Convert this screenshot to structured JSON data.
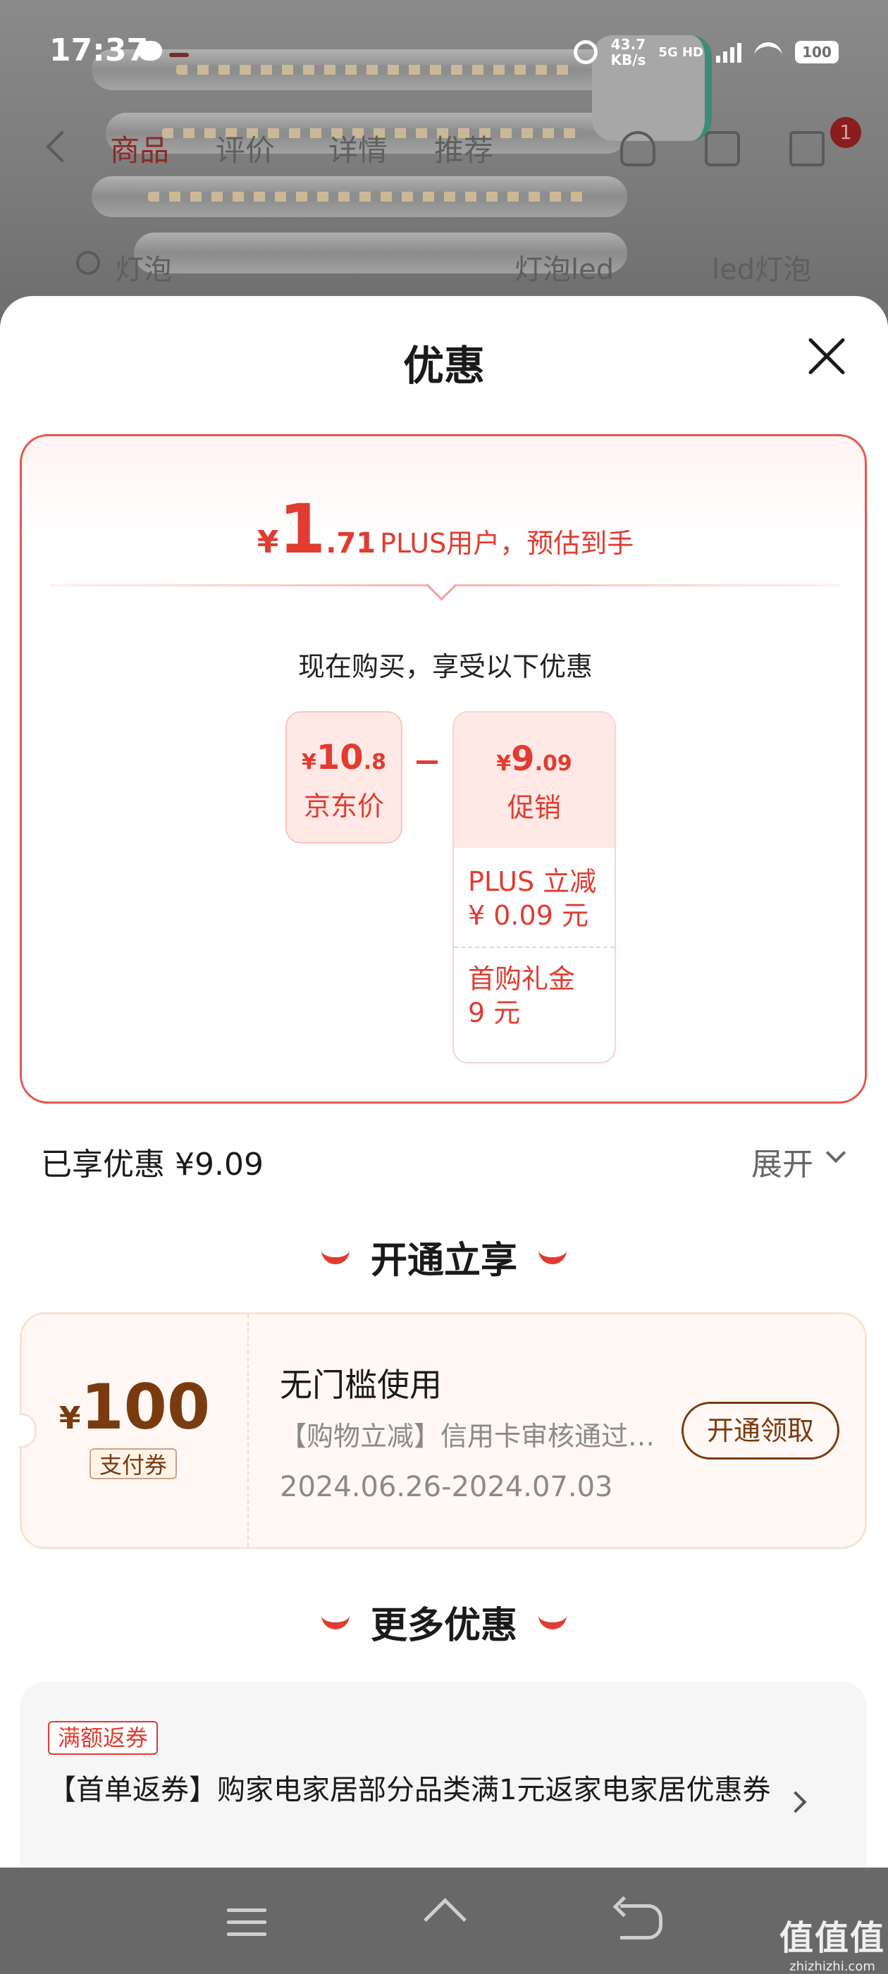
{
  "status_bar": {
    "time": "17:37",
    "net_speed_value": "43.7",
    "net_speed_unit": "KB/s",
    "network": "5G HD",
    "battery": "100"
  },
  "product_nav": {
    "tabs": [
      "商品",
      "评价",
      "详情",
      "推荐"
    ],
    "active_tab": "商品",
    "cart_badge": "1",
    "search_suggestions": [
      "灯泡",
      "灯泡led",
      "led灯泡"
    ]
  },
  "sheet": {
    "title": "优惠",
    "estimate": {
      "currency": "¥",
      "integer": "1",
      "decimal": ".71",
      "text": "PLUS用户，预估到手"
    },
    "buy_now_text": "现在购买，享受以下优惠",
    "jd_price": {
      "currency": "¥",
      "integer": "10",
      "decimal": ".8",
      "label": "京东价"
    },
    "promo": {
      "currency": "¥",
      "integer": "9",
      "decimal": ".09",
      "label": "促销",
      "items": [
        {
          "line1": "PLUS 立减",
          "line2": "¥ 0.09 元"
        },
        {
          "line1": "首购礼金",
          "line2": "9 元"
        }
      ]
    },
    "saved_text": "已享优惠 ¥9.09",
    "expand_label": "展开",
    "open_section_title": "开通立享",
    "coupon": {
      "currency": "¥",
      "amount": "100",
      "badge": "支付券",
      "title": "无门槛使用",
      "desc": "【购物立减】信用卡审核通过后可用",
      "date_range": "2024.06.26-2024.07.03",
      "button": "开通领取"
    },
    "more_section_title": "更多优惠",
    "more": {
      "tag": "满额返券",
      "text": "【首单返券】购家电家居部分品类满1元返家电家居优惠券"
    }
  },
  "watermark": {
    "main": "值值值",
    "sub": "zhizhizhi.com"
  },
  "colors": {
    "accent_red": "#e03c31",
    "coupon_brown": "#7a3a10"
  }
}
